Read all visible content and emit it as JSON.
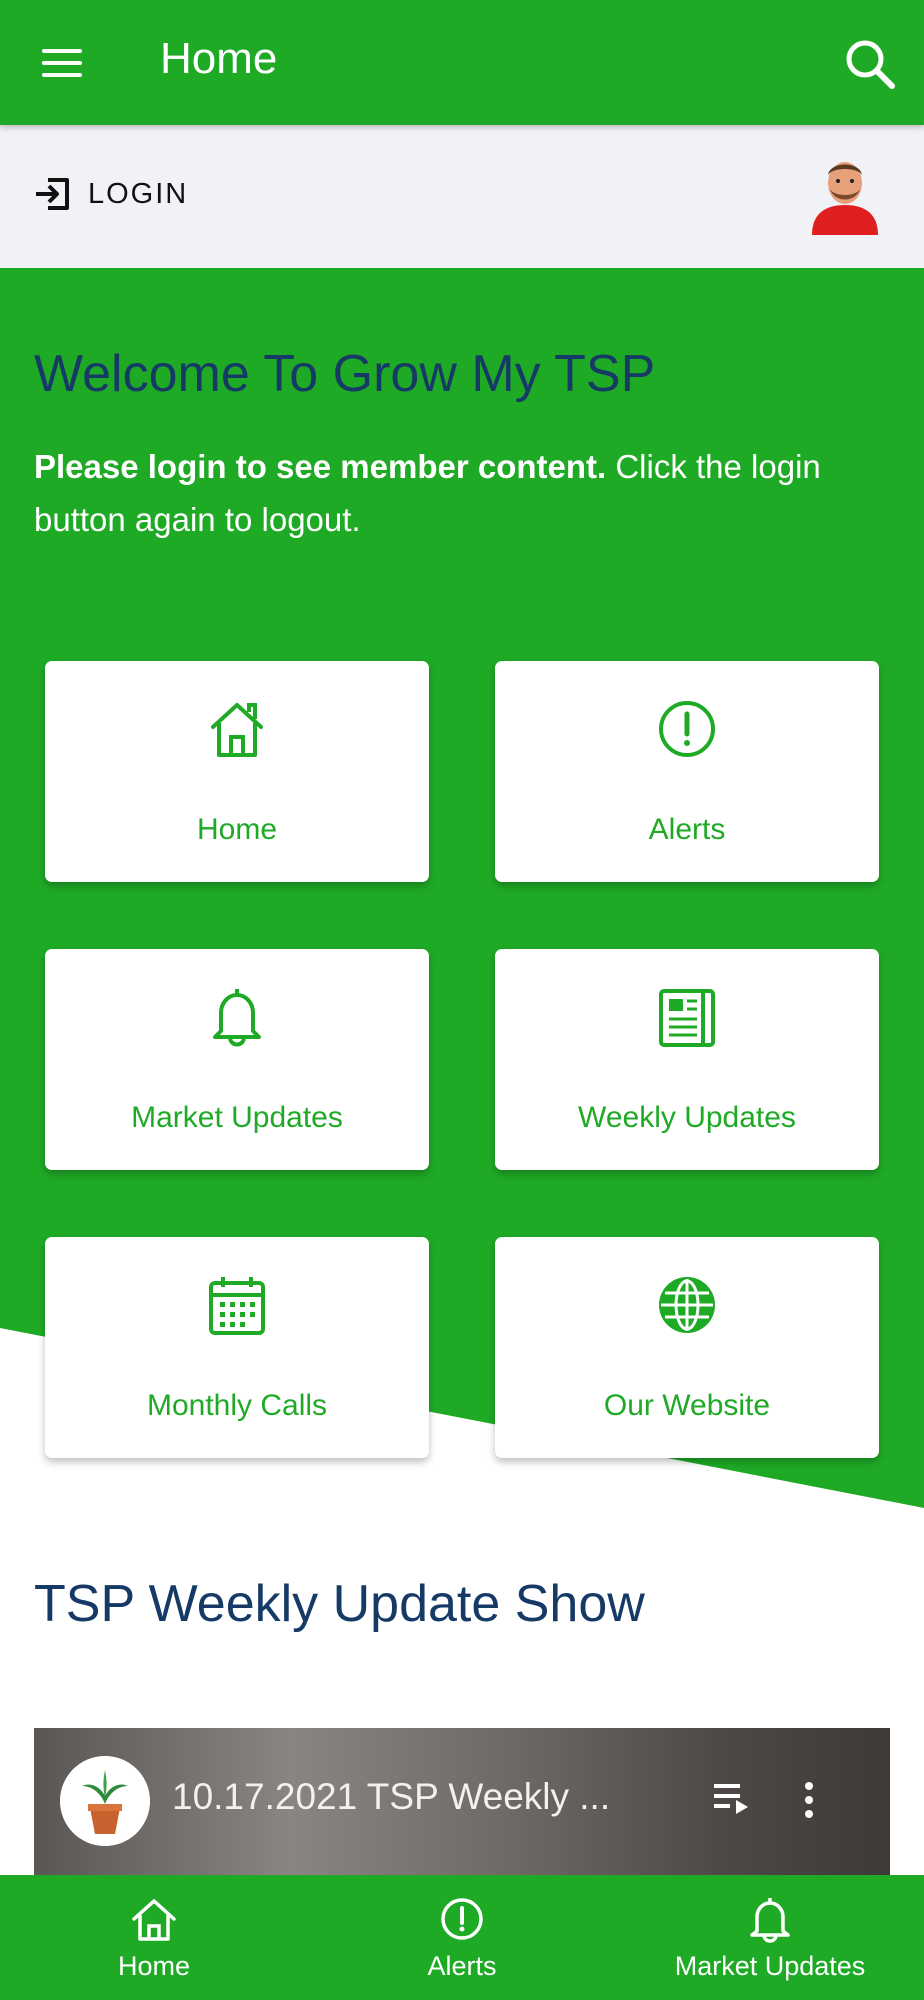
{
  "app_bar": {
    "title": "Home"
  },
  "login": {
    "label": "LOGIN"
  },
  "welcome": {
    "title": "Welcome To Grow My TSP",
    "bold_text": "Please login to see member content.",
    "text": " Click the login button again to logout."
  },
  "tiles": [
    {
      "label": "Home",
      "icon": "home-icon"
    },
    {
      "label": "Alerts",
      "icon": "alert-icon"
    },
    {
      "label": "Market Updates",
      "icon": "bell-icon"
    },
    {
      "label": "Weekly Updates",
      "icon": "newspaper-icon"
    },
    {
      "label": "Monthly Calls",
      "icon": "calendar-icon"
    },
    {
      "label": "Our Website",
      "icon": "globe-icon"
    }
  ],
  "show": {
    "title": "TSP Weekly Update Show",
    "video_title": "10.17.2021 TSP Weekly ..."
  },
  "bottom_nav": [
    {
      "label": "Home",
      "icon": "home-icon"
    },
    {
      "label": "Alerts",
      "icon": "alert-icon"
    },
    {
      "label": "Market Updates",
      "icon": "bell-icon"
    }
  ],
  "colors": {
    "brand_green": "#1faa26",
    "title_blue": "#163a66",
    "strip_gray": "#f1f2f6"
  }
}
